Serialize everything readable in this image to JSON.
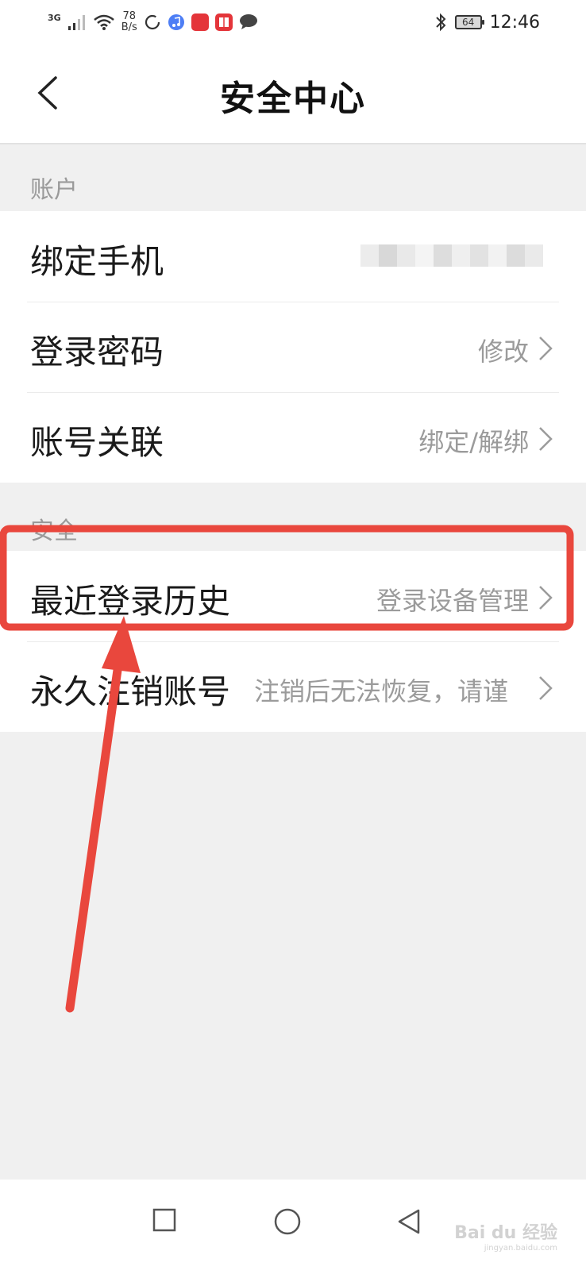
{
  "status_bar": {
    "network": "3G",
    "speed_value": "78",
    "speed_unit": "B/s",
    "battery": "64",
    "time": "12:46"
  },
  "header": {
    "title": "安全中心"
  },
  "sections": {
    "account": {
      "title": "账户",
      "rows": [
        {
          "label": "绑定手机",
          "value": ""
        },
        {
          "label": "登录密码",
          "value": "修改"
        },
        {
          "label": "账号关联",
          "value": "绑定/解绑"
        }
      ]
    },
    "security": {
      "title": "安全",
      "rows": [
        {
          "label": "最近登录历史",
          "value": "登录设备管理"
        },
        {
          "label": "永久注销账号",
          "value": "注销后无法恢复，请谨"
        }
      ]
    }
  },
  "watermark": {
    "brand": "Bai du 经验",
    "url": "jingyan.baidu.com"
  },
  "colors": {
    "annotation": "#e9473d",
    "value_text": "#9b9b9b",
    "section_text": "#9a9a9a"
  }
}
